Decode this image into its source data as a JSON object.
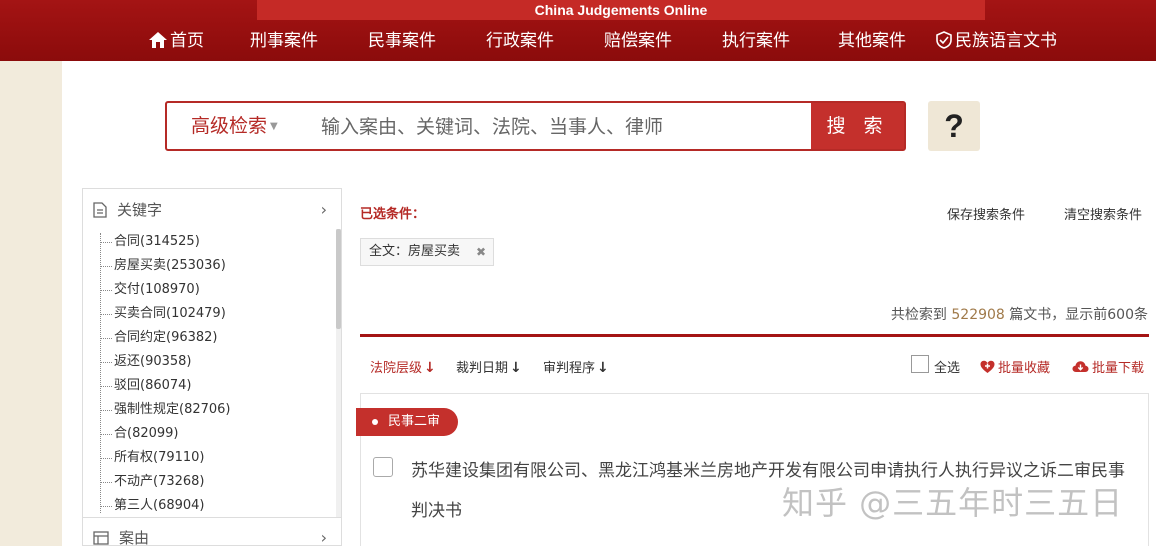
{
  "header": {
    "brand": "China Judgements Online",
    "nav": [
      {
        "label": "首页",
        "icon": "home-icon"
      },
      {
        "label": "刑事案件"
      },
      {
        "label": "民事案件"
      },
      {
        "label": "行政案件"
      },
      {
        "label": "赔偿案件"
      },
      {
        "label": "执行案件"
      },
      {
        "label": "其他案件"
      },
      {
        "label": "民族语言文书",
        "icon": "shield-icon"
      }
    ]
  },
  "search": {
    "advanced_label": "高级检索",
    "placeholder": "输入案由、关键词、法院、当事人、律师",
    "button_label": "搜 索",
    "help_label": "?"
  },
  "filters": {
    "keyword_title": "关键字",
    "keywords": [
      "合同(314525)",
      "房屋买卖(253036)",
      "交付(108970)",
      "买卖合同(102479)",
      "合同约定(96382)",
      "返还(90358)",
      "驳回(86074)",
      "强制性规定(82706)",
      "合(82099)",
      "所有权(79110)",
      "不动产(73268)",
      "第三人(68904)"
    ],
    "case_title": "案由"
  },
  "results": {
    "selected_label": "已选条件：",
    "save_conditions": "保存搜索条件",
    "clear_conditions": "清空搜索条件",
    "condition_tag": "全文：房屋买卖",
    "total_prefix": "共检索到 ",
    "total_count": "522908",
    "total_suffix": " 篇文书，显示前600条",
    "sort": [
      {
        "label": "法院层级",
        "arrow": "↓"
      },
      {
        "label": "裁判日期",
        "arrow": "↓"
      },
      {
        "label": "审判程序",
        "arrow": "↓"
      }
    ],
    "select_all": "全选",
    "batch_favorite": "批量收藏",
    "batch_download": "批量下载",
    "items": [
      {
        "badge": "民事二审",
        "title": "苏华建设集团有限公司、黑龙江鸿基米兰房地产开发有限公司申请执行人执行异议之诉二审民事判决书"
      }
    ]
  },
  "watermark": "知乎 @三五年时三五日",
  "colors": {
    "brand_red": "#a41414",
    "accent_red": "#c4302c",
    "bg_beige": "#f2ebdc"
  }
}
